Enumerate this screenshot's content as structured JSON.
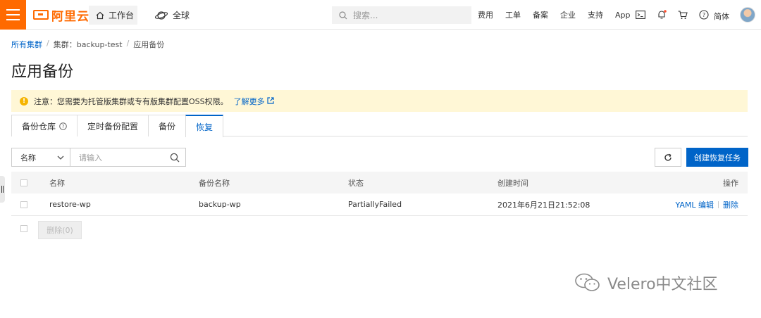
{
  "brand": {
    "name": "阿里云",
    "color": "#ff6a00"
  },
  "topbar": {
    "workbench": "工作台",
    "global": "全球",
    "search_placeholder": "搜索...",
    "links": [
      "费用",
      "工单",
      "备案",
      "企业",
      "支持",
      "App"
    ],
    "icons": [
      "terminal-icon",
      "bell-icon",
      "cart-icon",
      "help-icon"
    ],
    "language": "简体"
  },
  "breadcrumb": {
    "root": "所有集群",
    "cluster_prefix": "集群：",
    "cluster": "backup-test",
    "current": "应用备份"
  },
  "page_title": "应用备份",
  "notice": {
    "text": "注意：您需要为托管版集群或专有版集群配置OSS权限。",
    "link": "了解更多"
  },
  "tabs": [
    "备份仓库",
    "定时备份配置",
    "备份",
    "恢复"
  ],
  "active_tab": "恢复",
  "filter": {
    "field": "名称",
    "placeholder": "请输入"
  },
  "actions": {
    "create": "创建恢复任务"
  },
  "table": {
    "columns": [
      "名称",
      "备份名称",
      "状态",
      "创建时间",
      "操作"
    ],
    "rows": [
      {
        "name": "restore-wp",
        "backup": "backup-wp",
        "status": "PartiallyFailed",
        "created": "2021年6月21日21:52:08",
        "ops": [
          "YAML 编辑",
          "删除"
        ]
      }
    ],
    "bulk_delete": "删除(0)"
  },
  "watermark": "Velero中文社区",
  "accent_color": "#0064c8"
}
